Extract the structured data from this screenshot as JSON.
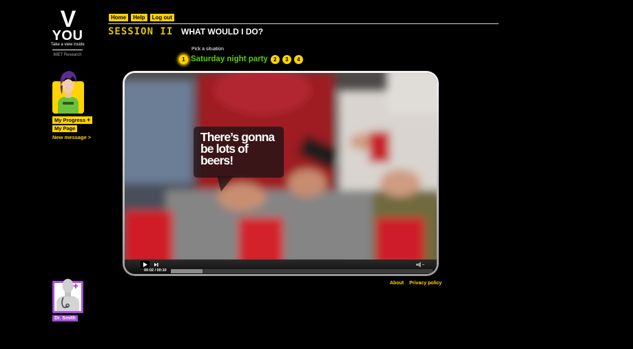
{
  "logo": {
    "mark": "V",
    "wordmark": "YOU",
    "tagline": "Take a view inside",
    "org": "iMET Research"
  },
  "sidebar": {
    "my_progress_label": "My Progress",
    "my_progress_plus": "+",
    "my_page_label": "My Page",
    "new_message_label": "New message >",
    "advisor_label": "Dr. Smith"
  },
  "nav": {
    "home": "Home",
    "help": "Help",
    "logout": "Log out"
  },
  "session": {
    "badge": "SESSION II",
    "title": "WHAT WOULD I DO?"
  },
  "situations": {
    "prompt": "Pick a situation",
    "current_number": "1",
    "current_label": "Saturday night party",
    "others": [
      "2",
      "3",
      "4"
    ]
  },
  "video": {
    "caption": "There’s gonna be lots of beers!",
    "time": "00:02 / 00:10",
    "elapsed_seconds": 2,
    "duration_seconds": 10,
    "buffered_fraction": 0.12
  },
  "footer": {
    "about": "About",
    "privacy": "Privacy policy"
  },
  "colors": {
    "accent": "#ffd400",
    "situation_green": "#5ad000",
    "advisor_purple": "#a64ddb",
    "background": "#000000"
  },
  "icons": [
    "play-icon",
    "skip-next-icon",
    "volume-mute-icon",
    "plus-icon",
    "student-avatar",
    "doctor-avatar"
  ]
}
